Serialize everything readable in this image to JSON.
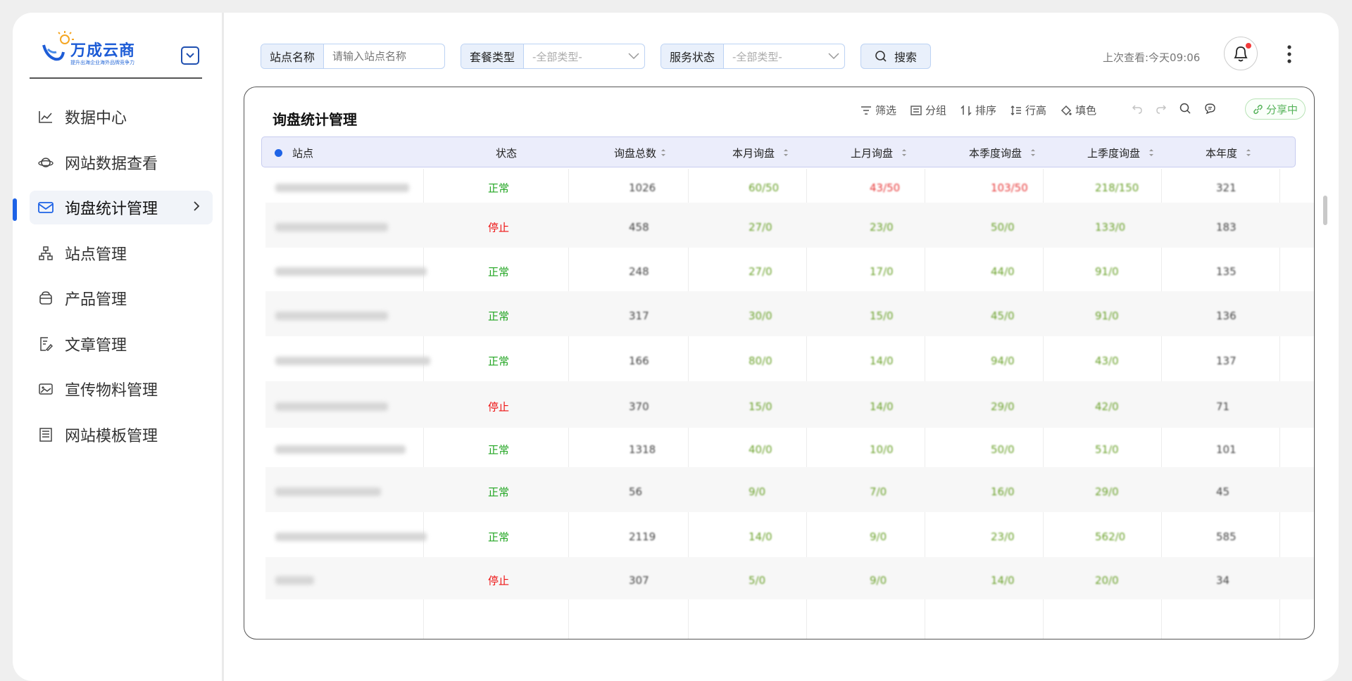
{
  "brand": {
    "name": "万成云商",
    "tagline": "提升出海企业海外品牌竞争力"
  },
  "nav": [
    {
      "label": "数据中心",
      "icon": "line-chart-icon"
    },
    {
      "label": "网站数据查看",
      "icon": "planet-icon"
    },
    {
      "label": "询盘统计管理",
      "icon": "mail-icon",
      "active": true
    },
    {
      "label": "站点管理",
      "icon": "sitemap-icon"
    },
    {
      "label": "产品管理",
      "icon": "box-icon"
    },
    {
      "label": "文章管理",
      "icon": "edit-doc-icon"
    },
    {
      "label": "宣传物料管理",
      "icon": "image-icon"
    },
    {
      "label": "网站模板管理",
      "icon": "template-icon"
    }
  ],
  "filters": {
    "site": {
      "label": "站点名称",
      "placeholder": "请输入站点名称"
    },
    "package": {
      "label": "套餐类型",
      "value": "-全部类型-"
    },
    "service": {
      "label": "服务状态",
      "value": "-全部类型-"
    },
    "search_label": "搜索"
  },
  "header": {
    "last_view": "上次查看:今天09:06"
  },
  "card": {
    "title": "询盘统计管理",
    "toolbar": {
      "filter": "筛选",
      "group": "分组",
      "sort": "排序",
      "row_height": "行高",
      "fill": "填色",
      "share": "分享中"
    }
  },
  "table": {
    "columns": [
      "站点",
      "状态",
      "询盘总数",
      "本月询盘",
      "上月询盘",
      "本季度询盘",
      "上季度询盘",
      "本年度"
    ],
    "rows": [
      {
        "status": "正常",
        "total": "1026",
        "month": "60/50",
        "last_month": "43/50",
        "quarter": "103/50",
        "last_quarter": "218/150",
        "year": "321"
      },
      {
        "status": "停止",
        "total": "458",
        "month": "27/0",
        "last_month": "23/0",
        "quarter": "50/0",
        "last_quarter": "133/0",
        "year": "183"
      },
      {
        "status": "正常",
        "total": "248",
        "month": "27/0",
        "last_month": "17/0",
        "quarter": "44/0",
        "last_quarter": "91/0",
        "year": "135"
      },
      {
        "status": "正常",
        "total": "317",
        "month": "30/0",
        "last_month": "15/0",
        "quarter": "45/0",
        "last_quarter": "91/0",
        "year": "136"
      },
      {
        "status": "正常",
        "total": "166",
        "month": "80/0",
        "last_month": "14/0",
        "quarter": "94/0",
        "last_quarter": "43/0",
        "year": "137"
      },
      {
        "status": "停止",
        "total": "370",
        "month": "15/0",
        "last_month": "14/0",
        "quarter": "29/0",
        "last_quarter": "42/0",
        "year": "71"
      },
      {
        "status": "正常",
        "total": "1318",
        "month": "40/0",
        "last_month": "10/0",
        "quarter": "50/0",
        "last_quarter": "51/0",
        "year": "101"
      },
      {
        "status": "正常",
        "total": "56",
        "month": "9/0",
        "last_month": "7/0",
        "quarter": "16/0",
        "last_quarter": "29/0",
        "year": "45"
      },
      {
        "status": "正常",
        "total": "2119",
        "month": "14/0",
        "last_month": "9/0",
        "quarter": "23/0",
        "last_quarter": "562/0",
        "year": "585"
      },
      {
        "status": "停止",
        "total": "307",
        "month": "5/0",
        "last_month": "9/0",
        "quarter": "14/0",
        "last_quarter": "20/0",
        "year": "34"
      }
    ]
  },
  "colors": {
    "accent": "#1e63e6",
    "ok": "#21a521",
    "stop": "#e11111",
    "over_target": "#e73939",
    "normal_value": "#6aa12a"
  }
}
